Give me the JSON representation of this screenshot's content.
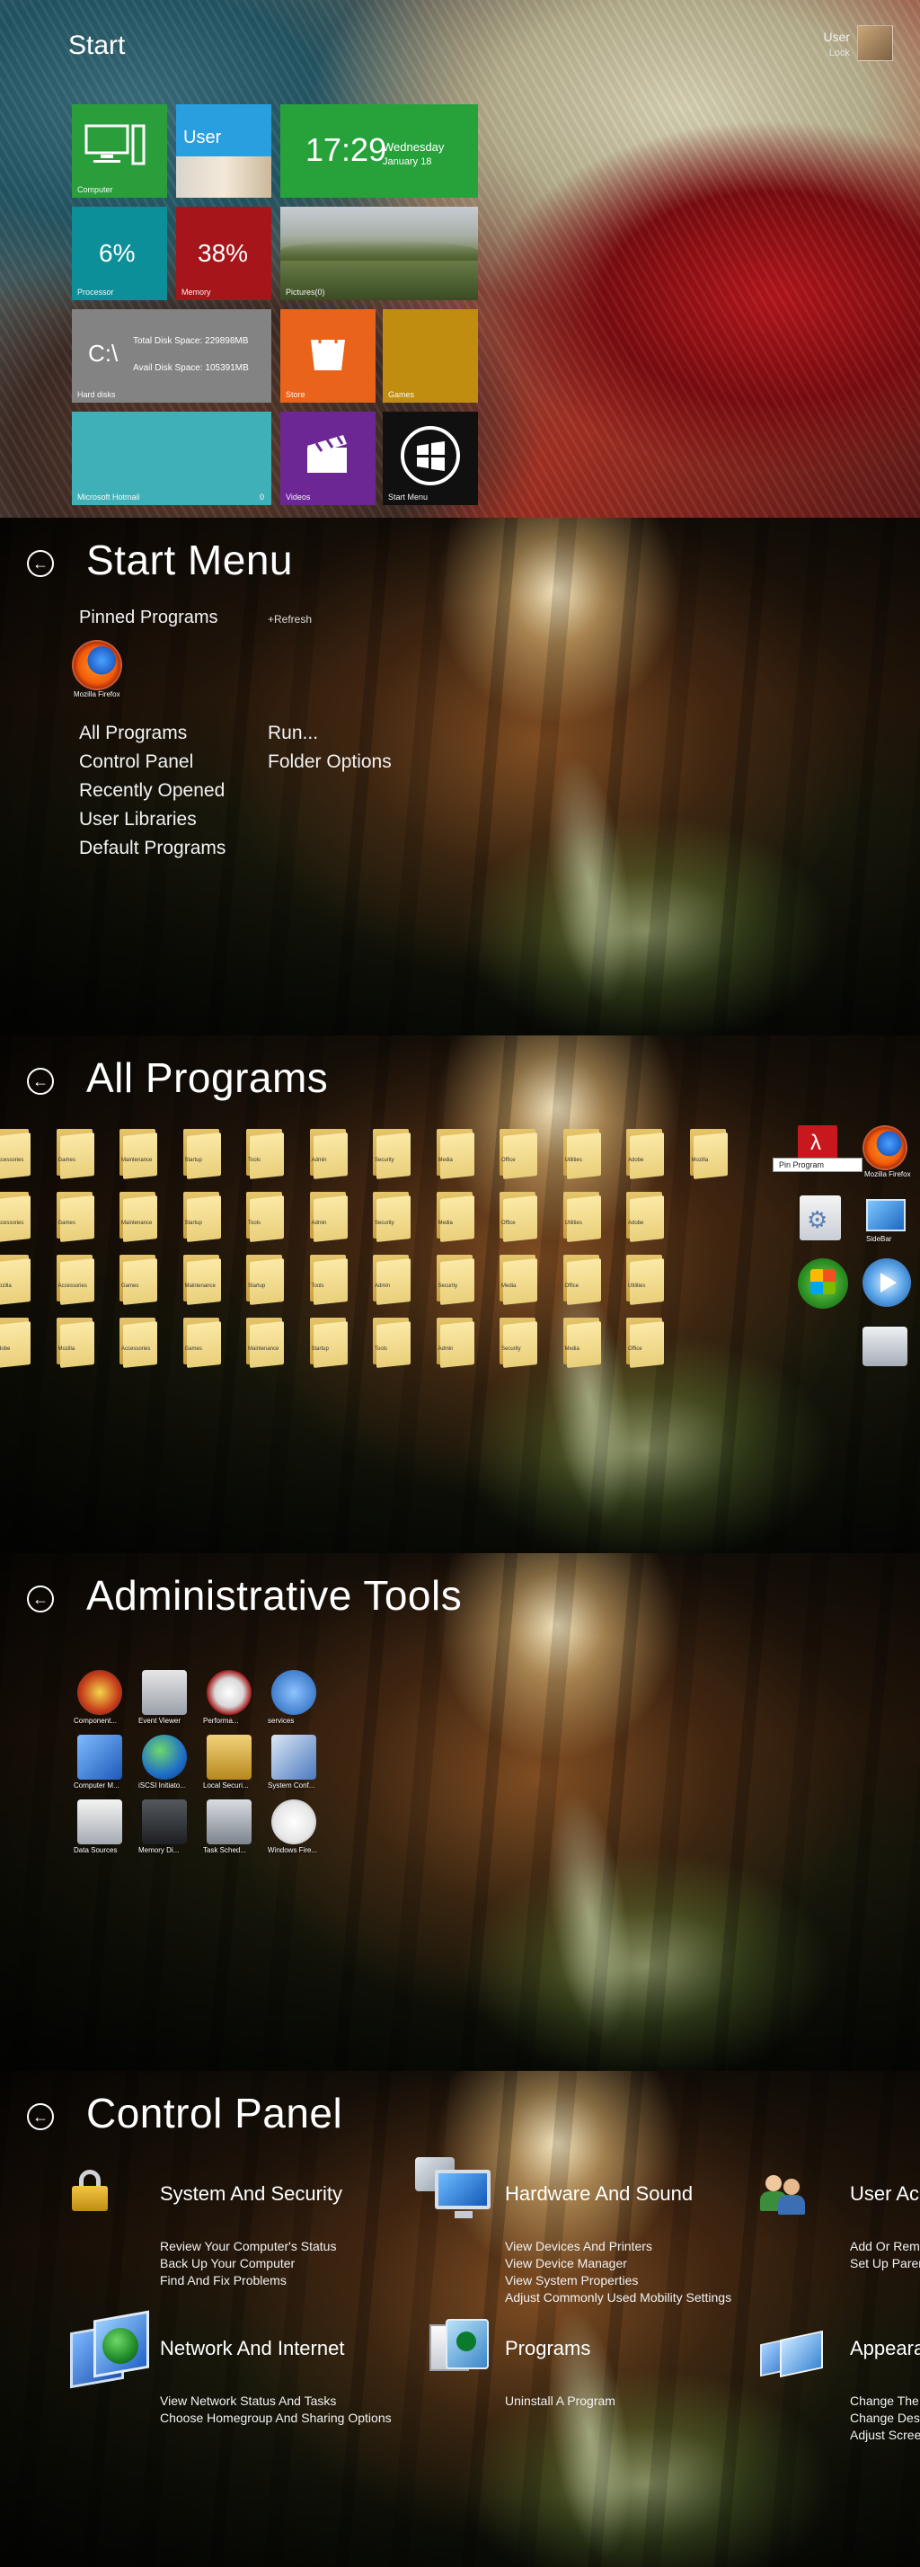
{
  "start": {
    "title": "Start",
    "user_name": "User",
    "user_sub": "Lock",
    "tiles": {
      "computer_label": "Computer",
      "user_label": "User",
      "clock_time": "17:29",
      "clock_day": "Wednesday",
      "clock_date": "January 18",
      "processor_value": "6%",
      "processor_label": "Processor",
      "memory_value": "38%",
      "memory_label": "Memory",
      "pictures_label": "Pictures(0)",
      "disk_icon": "C:\\",
      "disk_total": "Total Disk Space: 229898MB",
      "disk_avail": "Avail Disk Space: 105391MB",
      "disk_label": "Hard disks",
      "store_label": "Store",
      "games_label": "Games",
      "hotmail_label": "Microsoft Hotmail",
      "hotmail_count": "0",
      "videos_label": "Videos",
      "startmenu_label": "Start Menu"
    },
    "colors": {
      "green": "#2a9e3a",
      "blue": "#2a9fe0",
      "clock_green": "#27a23b",
      "teal": "#0c8f98",
      "darkred": "#a5151a",
      "gray": "#838383",
      "orange": "#e9641a",
      "gold": "#c08d10",
      "hotmail_teal": "#3fb0b8",
      "purple": "#6d2795",
      "black": "#101010"
    }
  },
  "start_menu": {
    "title": "Start Menu",
    "pinned_label": "Pinned Programs",
    "refresh_label": "+Refresh",
    "pinned_app_label": "Mozilla Firefox",
    "links_left": [
      "All Programs",
      "Control Panel",
      "Recently Opened",
      "User Libraries",
      "Default Programs"
    ],
    "links_right": [
      "Run...",
      "Folder Options"
    ]
  },
  "all_programs": {
    "title": "All Programs",
    "folder_labels": [
      "Accessories",
      "Games",
      "Maintenance",
      "Startup",
      "Tools",
      "Admin",
      "Security",
      "Media",
      "Office",
      "Utilities",
      "Adobe",
      "Mozilla"
    ],
    "tooltip": "Pin Program",
    "firefox_label": "Mozilla Firefox",
    "sidebar_label": "SideBar"
  },
  "admin_tools": {
    "title": "Administrative Tools",
    "icons": [
      "Component...",
      "Event Viewer",
      "Performa...",
      "services",
      "Computer M...",
      "iSCSI Initiato...",
      "Local Securi...",
      "System Conf...",
      "Data Sources",
      "Memory Di...",
      "Task Sched...",
      "Windows Fire..."
    ]
  },
  "control_panel": {
    "title": "Control Panel",
    "categories": [
      {
        "title": "System And Security",
        "links": [
          "Review Your Computer's Status",
          "Back Up Your Computer",
          "Find And Fix Problems"
        ]
      },
      {
        "title": "Hardware And Sound",
        "links": [
          "View Devices And Printers",
          "View Device Manager",
          "View System Properties",
          "Adjust Commonly Used Mobility Settings"
        ]
      },
      {
        "title": "User Accounts",
        "links": [
          "Add Or Remove",
          "Set Up Parental"
        ]
      },
      {
        "title": "Network And Internet",
        "links": [
          "View Network Status And Tasks",
          "Choose Homegroup And Sharing Options"
        ]
      },
      {
        "title": "Programs",
        "links": [
          "Uninstall A Program"
        ]
      },
      {
        "title": "Appearance",
        "links": [
          "Change The",
          "Change Des",
          "Adjust Scree"
        ]
      }
    ]
  }
}
